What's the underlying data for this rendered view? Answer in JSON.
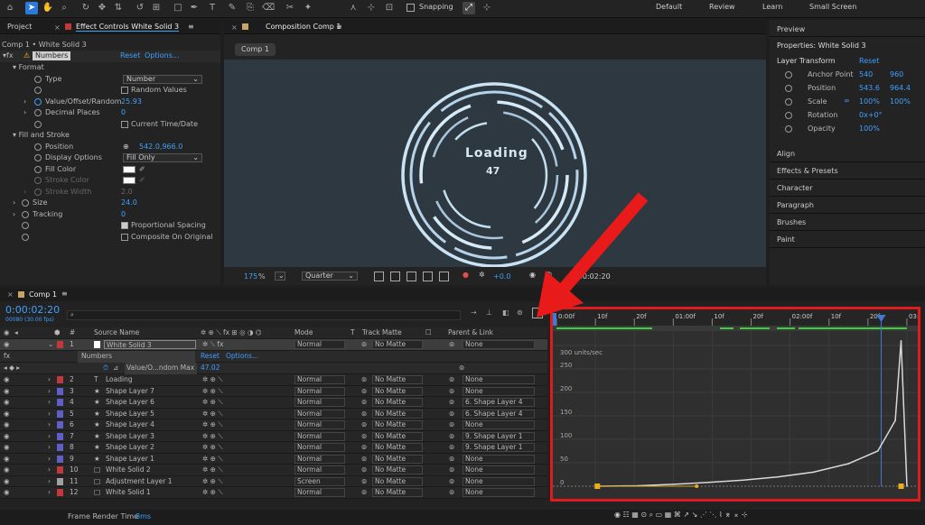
{
  "toolbar": {
    "snapping": "Snapping",
    "workspaces": [
      "Default",
      "Review",
      "Learn",
      "Small Screen"
    ]
  },
  "effect_controls": {
    "tabs": [
      "Project",
      "Effect Controls White Solid 3"
    ],
    "breadcrumb": "Comp 1 • White Solid 3",
    "effect_name": "Numbers",
    "reset": "Reset",
    "options": "Options...",
    "format_label": "Format",
    "type_label": "Type",
    "type_value": "Number",
    "random_values": "Random Values",
    "value_label": "Value/Offset/Random",
    "value_value": "25.93",
    "decimal_label": "Decimal Places",
    "decimal_value": "0",
    "current_time": "Current Time/Date",
    "fill_stroke": "Fill and Stroke",
    "position_label": "Position",
    "position_value": "542.0,966.0",
    "display_label": "Display Options",
    "display_value": "Fill Only",
    "fill_color": "Fill Color",
    "stroke_color": "Stroke Color",
    "stroke_width": "Stroke Width",
    "stroke_width_value": "2.0",
    "size_label": "Size",
    "size_value": "24.0",
    "tracking_label": "Tracking",
    "tracking_value": "0",
    "proportional": "Proportional Spacing",
    "composite": "Composite On Original"
  },
  "composition": {
    "tab": "Composition Comp 1",
    "comp_button": "Comp 1",
    "loading_text": "Loading",
    "number_text": "47",
    "zoom": "175",
    "zoom_unit": "%",
    "resolution": "Quarter",
    "exposure": "+0.0",
    "timecode": "0:00:02:20"
  },
  "right_panel": {
    "preview": "Preview",
    "properties_title": "Properties: White Solid 3",
    "layer_transform": "Layer Transform",
    "reset": "Reset",
    "anchor_label": "Anchor Point",
    "anchor_x": "540",
    "anchor_y": "960",
    "position_label": "Position",
    "position_x": "543.6",
    "position_y": "964.4",
    "scale_label": "Scale",
    "scale_x": "100%",
    "scale_y": "100%",
    "rotation_label": "Rotation",
    "rotation_value": "0x+0°",
    "opacity_label": "Opacity",
    "opacity_value": "100%",
    "panels": [
      "Align",
      "Effects & Presets",
      "Character",
      "Paragraph",
      "Brushes",
      "Paint"
    ]
  },
  "timeline": {
    "tab": "Comp 1",
    "timecode": "0:00:02:20",
    "fps": "00080 (30.00 fps)",
    "search_placeholder": "",
    "headers": {
      "num": "#",
      "source": "Source Name",
      "mode": "Mode",
      "t": "T",
      "track": "Track Matte",
      "parent": "Parent & Link"
    },
    "selected_layer": {
      "num": "1",
      "name": "White Solid 3",
      "mode": "Normal",
      "matte": "No Matte",
      "parent": "None"
    },
    "numbers_effect": "Numbers",
    "reset": "Reset",
    "options": "Options...",
    "prop_name": "Value/O...ndom Max",
    "prop_value": "47.02",
    "layers": [
      {
        "num": "2",
        "icon": "T",
        "name": "Loading",
        "mode": "Normal",
        "matte": "No Matte",
        "parent": "None",
        "color": "#c0393b"
      },
      {
        "num": "3",
        "icon": "★",
        "name": "Shape Layer 7",
        "mode": "Normal",
        "matte": "No Matte",
        "parent": "None",
        "color": "#5e60c8"
      },
      {
        "num": "4",
        "icon": "★",
        "name": "Shape Layer 6",
        "mode": "Normal",
        "matte": "No Matte",
        "parent": "6. Shape Layer 4",
        "color": "#5e60c8"
      },
      {
        "num": "5",
        "icon": "★",
        "name": "Shape Layer 5",
        "mode": "Normal",
        "matte": "No Matte",
        "parent": "6. Shape Layer 4",
        "color": "#5e60c8"
      },
      {
        "num": "6",
        "icon": "★",
        "name": "Shape Layer 4",
        "mode": "Normal",
        "matte": "No Matte",
        "parent": "None",
        "color": "#5e60c8"
      },
      {
        "num": "7",
        "icon": "★",
        "name": "Shape Layer 3",
        "mode": "Normal",
        "matte": "No Matte",
        "parent": "9. Shape Layer 1",
        "color": "#5e60c8"
      },
      {
        "num": "8",
        "icon": "★",
        "name": "Shape Layer 2",
        "mode": "Normal",
        "matte": "No Matte",
        "parent": "9. Shape Layer 1",
        "color": "#5e60c8"
      },
      {
        "num": "9",
        "icon": "★",
        "name": "Shape Layer 1",
        "mode": "Normal",
        "matte": "No Matte",
        "parent": "None",
        "color": "#5e60c8"
      },
      {
        "num": "10",
        "icon": "□",
        "name": "White Solid 2",
        "mode": "Normal",
        "matte": "No Matte",
        "parent": "None",
        "color": "#c0393b"
      },
      {
        "num": "11",
        "icon": "□",
        "name": "Adjustment Layer 1",
        "mode": "Screen",
        "matte": "No Matte",
        "parent": "None",
        "color": "#a0a0a0"
      },
      {
        "num": "12",
        "icon": "□",
        "name": "White Solid 1",
        "mode": "Normal",
        "matte": "No Matte",
        "parent": "None",
        "color": "#c0393b"
      }
    ],
    "footer": "Frame Render Time",
    "footer_value": "8ms"
  },
  "graph": {
    "ruler_labels": [
      "0:00f",
      "10f",
      "20f",
      "01:00f",
      "10f",
      "20f",
      "02:00f",
      "10f",
      "20f",
      "03:00f"
    ],
    "unit_label": "300 units/sec",
    "y_labels": [
      "250",
      "200",
      "150",
      "100",
      "50",
      "0"
    ]
  },
  "chart_data": {
    "type": "line",
    "title": "",
    "ylabel": "units/sec",
    "xlabel": "",
    "ylim": [
      0,
      300
    ],
    "x_ticks": [
      "0:00f",
      "10f",
      "20f",
      "01:00f",
      "10f",
      "20f",
      "02:00f",
      "10f",
      "20f",
      "03:00f"
    ],
    "y_ticks": [
      0,
      50,
      100,
      150,
      200,
      250,
      300
    ],
    "series": [
      {
        "x": [
          0.35,
          0.7,
          1.0,
          1.3,
          1.6,
          1.9,
          2.2,
          2.5,
          2.75,
          2.9,
          2.95,
          3.0
        ],
        "values": [
          0,
          1,
          4,
          8,
          13,
          20,
          30,
          48,
          75,
          140,
          310,
          0
        ]
      }
    ]
  },
  "annotation_colors": {
    "arrow": "#e81a1a",
    "box": "#e01b1b",
    "accent": "#3ea0ff"
  }
}
